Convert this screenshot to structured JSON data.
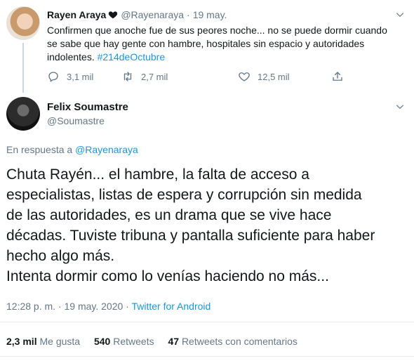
{
  "parent_tweet": {
    "author_name": "Rayen Araya",
    "handle": "@Rayenaraya",
    "separator": "·",
    "date": "19 may.",
    "text": "Confirmen que anoche fue de sus peores noche... no se puede dormir cuando se sabe que hay gente con hambre, hospitales sin espacio y autoridades indolentes. ",
    "hashtag": "#214deOctubre",
    "actions": {
      "replies": "3,1 mil",
      "retweets": "2,7 mil",
      "likes": "12,5 mil"
    }
  },
  "main_tweet": {
    "author_name": "Felix Soumastre",
    "handle": "@Soumastre",
    "reply_prefix": "En respuesta a",
    "reply_to": "@Rayenaraya",
    "text_lines": [
      "Chuta Rayén... el hambre, la falta de acceso a",
      "especialistas, listas de espera y corrupción sin medida",
      "de las autoridades, es un drama que se vive hace",
      "décadas. Tuviste tribuna y pantalla suficiente para haber",
      "hecho algo más.",
      "Intenta dormir como lo venías haciendo no más..."
    ],
    "timestamp": "12:28 p. m. · 19 may. 2020 · ",
    "source": "Twitter for Android",
    "stats": {
      "likes_count": "2,3 mil",
      "likes_label": "Me gusta",
      "retweets_count": "540",
      "retweets_label": "Retweets",
      "quotes_count": "47",
      "quotes_label": "Retweets con comentarios"
    }
  },
  "colors": {
    "link": "#1b95e0",
    "secondary_text": "#657786",
    "primary_text": "#14171a",
    "divider": "#e6ecf0"
  },
  "icons": [
    "heart-glyph-icon",
    "chevron-down-icon",
    "reply-icon",
    "retweet-icon",
    "like-icon",
    "share-icon"
  ]
}
